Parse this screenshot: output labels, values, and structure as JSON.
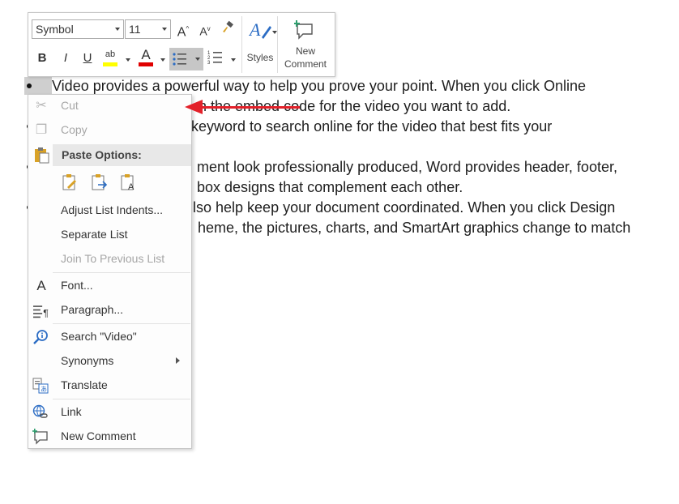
{
  "document": {
    "lines": [
      "Video provides a powerful way to help you prove your point. When you click Online",
      "n the embed code for the video you want to add.",
      "keyword to search online for the video that best fits your",
      "ment look professionally produced, Word provides header, footer,",
      "box designs that complement each other.",
      "lso help keep your document coordinated. When you click Design",
      "heme, the pictures, charts, and SmartArt graphics change to match"
    ]
  },
  "mini_toolbar": {
    "font_name": "Symbol",
    "font_size": "11",
    "grow_font": "A",
    "shrink_font": "A",
    "bold": "B",
    "italic": "I",
    "underline": "U",
    "highlight": "ab",
    "font_color": "A",
    "styles_label": "Styles",
    "new_comment_line1": "New",
    "new_comment_line2": "Comment",
    "colors": {
      "highlight": "#ffff00",
      "font_color": "#e00000"
    }
  },
  "context_menu": {
    "cut": "Cut",
    "copy": "Copy",
    "paste_options": "Paste Options:",
    "adjust_list_indents": "Adjust List Indents...",
    "separate_list": "Separate List",
    "join_to_previous_list": "Join To Previous List",
    "font": "Font...",
    "paragraph": "Paragraph...",
    "search": "Search \"Video\"",
    "synonyms": "Synonyms",
    "translate": "Translate",
    "link": "Link",
    "new_comment": "New Comment"
  },
  "annotation": {
    "arrow_color": "#e3212a"
  }
}
